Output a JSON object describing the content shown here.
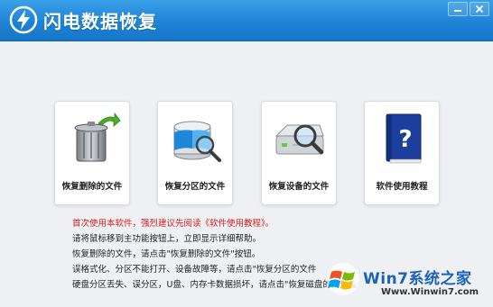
{
  "app": {
    "title": "闪电数据恢复",
    "accent_color": "#1e84d6",
    "logo_icon": "lightning-bolt-icon"
  },
  "window_controls": [
    {
      "name": "minimize-button",
      "icon": "minimize-icon"
    },
    {
      "name": "close-button",
      "icon": "close-icon"
    }
  ],
  "cards": [
    {
      "label": "恢复删除的文件",
      "icon": "trash-restore-icon"
    },
    {
      "label": "恢复分区的文件",
      "icon": "partition-search-icon"
    },
    {
      "label": "恢复设备的文件",
      "icon": "drive-search-icon"
    },
    {
      "label": "软件使用教程",
      "icon": "help-book-icon"
    }
  ],
  "help": {
    "warning": "首次使用本软件，强烈建议先阅读《软件使用教程》。",
    "lines": [
      "请将鼠标移到主功能按钮上，立即显示详细帮助。",
      "恢复删除的文件，请点击\"恢复删除的文件\"按钮。",
      "误格式化、分区不能打开、设备故障等，请点击\"恢复分区的文件",
      "硬盘分区丢失、误分区，U盘、内存卡数据损坏，请点击\"恢复磁盘的文件\"。"
    ]
  },
  "watermark": {
    "brand": "Win7系统之家",
    "url": "Www.Winwin7.com"
  }
}
